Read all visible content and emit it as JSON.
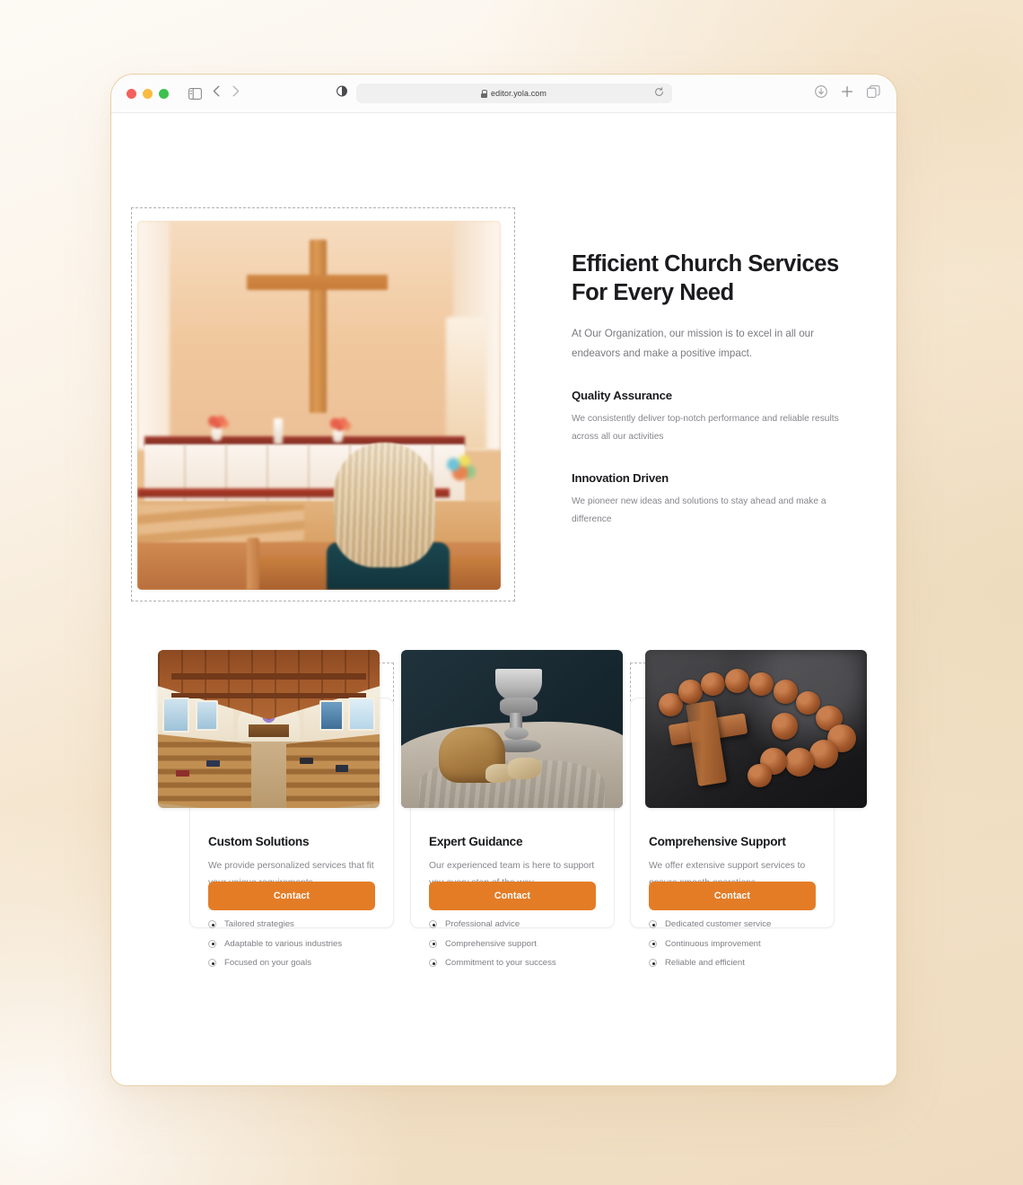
{
  "browser": {
    "url": "editor.yola.com",
    "icons": {
      "traffic_close": "close-traffic-light",
      "traffic_minimize": "minimize-traffic-light",
      "traffic_zoom": "zoom-traffic-light",
      "sidebar": "sidebar-toggle-icon",
      "back": "back-chevron-icon",
      "forward": "forward-chevron-icon",
      "reader": "reader-view-icon",
      "lock": "lock-icon",
      "reload": "reload-icon",
      "downloads": "downloads-icon",
      "new_tab": "plus-icon",
      "tab_overview": "tab-overview-icon"
    }
  },
  "hero": {
    "image_alt": "church-interior-woman-praying",
    "headline": "Efficient Church Services For Every Need",
    "lede": "At Our Organization, our mission is to excel in all our endeavors and make a positive impact.",
    "features": [
      {
        "title": "Quality Assurance",
        "body": "We consistently deliver top-notch performance and reliable results across all our activities"
      },
      {
        "title": "Innovation Driven",
        "body": "We pioneer new ideas and solutions to stay ahead and make a difference"
      }
    ]
  },
  "cards": [
    {
      "image_alt": "church-pews-interior",
      "title": "Custom Solutions",
      "desc": "We provide personalized services that fit your unique requirements",
      "bullets": [
        "Tailored strategies",
        "Adaptable to various industries",
        "Focused on your goals"
      ],
      "button": "Contact"
    },
    {
      "image_alt": "communion-bread-and-chalice",
      "title": "Expert Guidance",
      "desc": "Our experienced team is here to support you every step of the way",
      "bullets": [
        "Professional advice",
        "Comprehensive support",
        "Commitment to your success"
      ],
      "button": "Contact"
    },
    {
      "image_alt": "wooden-rosary-cross",
      "title": "Comprehensive Support",
      "desc": "We offer extensive support services to ensure smooth operations",
      "bullets": [
        "Dedicated customer service",
        "Continuous improvement",
        "Reliable and efficient"
      ],
      "button": "Contact"
    }
  ],
  "colors": {
    "accent_orange": "#e47c26",
    "heading": "#1b1b1f",
    "body_text": "#86868c",
    "page_bg": "#ffffff",
    "canvas_bg": "#efdcc0",
    "selection_dash": "#b3b3b3"
  }
}
